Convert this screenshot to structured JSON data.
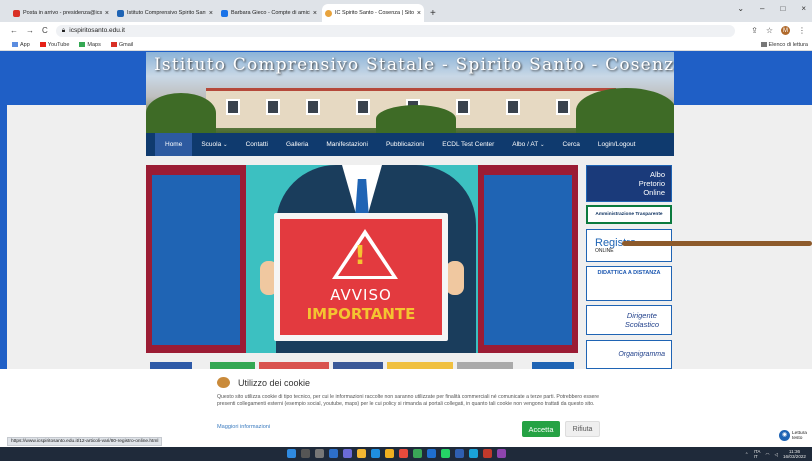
{
  "browser": {
    "tabs": [
      {
        "title": "Posta in arrivo - presidenza@icsp",
        "color": "#d93025",
        "active": false
      },
      {
        "title": "Istituto Comprensivo Spirito Sant",
        "color": "#1f64b4",
        "active": false
      },
      {
        "title": "Barbara Gieco - Compte di amici",
        "color": "#1a73e8",
        "active": false
      },
      {
        "title": "IC Spirito Santo - Cosenza | Sito",
        "color": "#e8a33d",
        "active": true
      }
    ],
    "new_tab": "+",
    "url": "icspiritosanto.edu.it",
    "avatar_letter": "M",
    "bookmarks": [
      "App",
      "YouTube",
      "Maps",
      "Gmail"
    ],
    "bookmarks_right": "Elenco di lettura"
  },
  "site": {
    "header_title": "Istituto Comprensivo Statale - Spirito Santo - Cosenza",
    "nav": [
      "Home",
      "Scuola",
      "Contatti",
      "Galleria",
      "Manifestazioni",
      "Pubblicazioni",
      "ECDL Test Center",
      "Albo / AT",
      "Cerca",
      "Login/Logout"
    ],
    "hero": {
      "line1": "AVVISO",
      "line2": "IMPORTANTE",
      "mark": "!"
    },
    "sidebar": {
      "albo": "Albo\nPretorio\nOnline",
      "amministrazione": "Amministrazione Trasparente",
      "registro": "Registro",
      "registro_sub": "ONLINE",
      "didattica": "DIDATTICA A DISTANZA",
      "dirigente": "Dirigente\nScolastico",
      "organigramma": "Organigramma"
    }
  },
  "cookie": {
    "title": "Utilizzo dei cookie",
    "text": "Questo sito utilizza cookie di tipo tecnico, per cui le informazioni raccolte non saranno utilizzate per finalità commerciali né comunicate a terze parti. Potrebbero essere presenti collegamenti esterni (esempio social, youtube, maps) per le cui policy si rimanda ai portali collegati, in quanto tali cookie non vengono trattati da questo sito.",
    "more": "Maggiori informazioni",
    "accept": "Accetta",
    "reject": "Rifiuta"
  },
  "status_url": "https://www.icspiritosanto.edu.it/12-articoli-vari/80-registro-online.html",
  "reader": {
    "label": "Lettura\ntesto"
  },
  "tray": {
    "lang": "ITA\nIT",
    "time": "11:36",
    "date": "16/03/2022"
  }
}
